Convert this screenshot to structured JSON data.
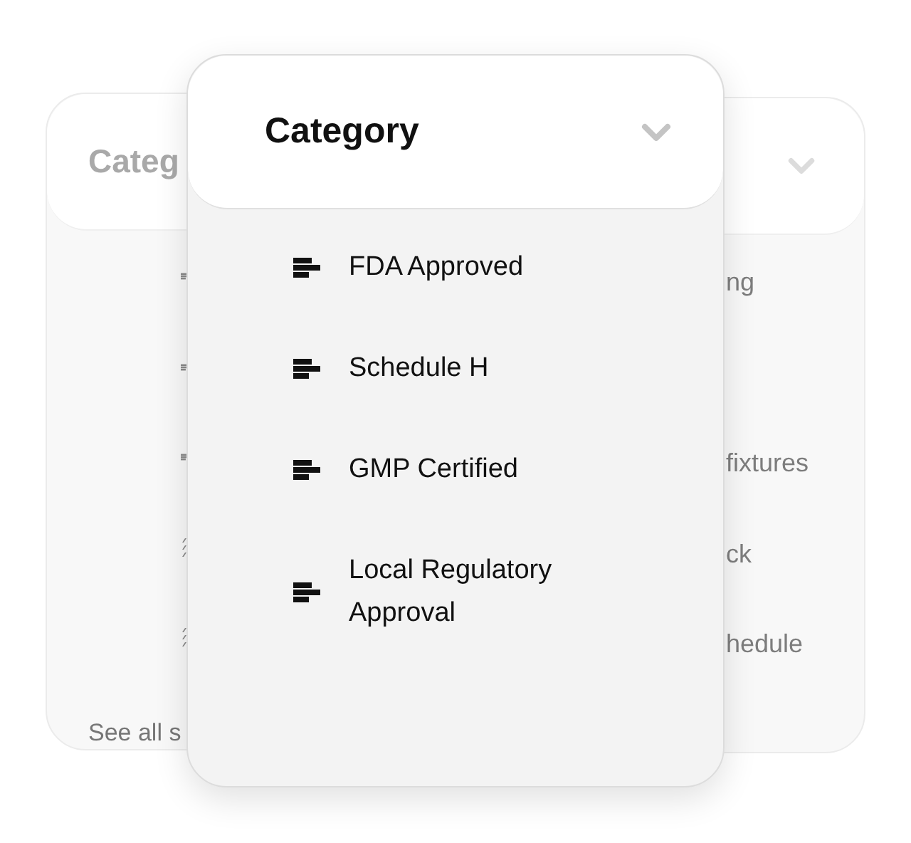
{
  "back_left_card": {
    "title": "Categ",
    "items": [
      {
        "kind": "bars"
      },
      {
        "kind": "bars"
      },
      {
        "kind": "bars"
      },
      {
        "kind": "slashes"
      },
      {
        "kind": "slashes"
      }
    ],
    "footer_link": "See all s"
  },
  "back_right_card": {
    "items": [
      {
        "kind": "text",
        "label": "ng"
      },
      {
        "kind": "empty"
      },
      {
        "kind": "text",
        "label": "fixtures"
      },
      {
        "kind": "text",
        "label": "ck"
      },
      {
        "kind": "text",
        "label": "hedule"
      }
    ]
  },
  "front_card": {
    "title": "Category",
    "expanded": true,
    "items": [
      {
        "label": "FDA Approved"
      },
      {
        "label": "Schedule H"
      },
      {
        "label": "GMP Certified"
      },
      {
        "label": "Local Regulatory Approval"
      }
    ]
  }
}
